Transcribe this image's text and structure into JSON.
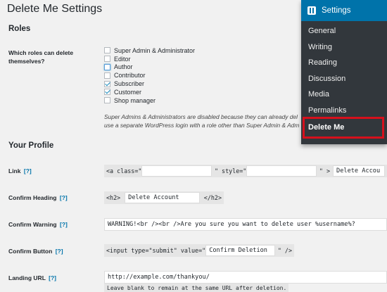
{
  "page": {
    "title": "Delete Me Settings"
  },
  "roles_section": {
    "heading": "Roles",
    "label": "Which roles can delete themselves?",
    "roles": [
      {
        "name": "Super Admin & Administrator",
        "checked": false
      },
      {
        "name": "Editor",
        "checked": false
      },
      {
        "name": "Author",
        "checked": false
      },
      {
        "name": "Contributor",
        "checked": false
      },
      {
        "name": "Subscriber",
        "checked": true
      },
      {
        "name": "Customer",
        "checked": true
      },
      {
        "name": "Shop manager",
        "checked": false
      }
    ],
    "note_line1": "Super Admins & Administrators are disabled because they can already del",
    "note_line2": "use a separate WordPress login with a role other than Super Admin & Adm"
  },
  "profile_section": {
    "heading": "Your Profile",
    "help": "[?]",
    "link": {
      "label": "Link",
      "code_a_open": "<a class=\"",
      "code_style": "\" style=\"",
      "code_close": "\" >",
      "class_value": "",
      "style_value": "",
      "text_value": "Delete Accou"
    },
    "confirm_heading": {
      "label": "Confirm Heading",
      "code_open": "<h2>",
      "value": "Delete Account",
      "code_close": "</h2>"
    },
    "confirm_warning": {
      "label": "Confirm Warning",
      "value": "WARNING!<br /><br />Are you sure you want to delete user %username%?"
    },
    "confirm_button": {
      "label": "Confirm Button",
      "code_open": "<input type=\"submit\" value=\"",
      "value": "Confirm Deletion",
      "code_close": "\" />"
    },
    "landing_url": {
      "label": "Landing URL",
      "value": "http://example.com/thankyou/",
      "description": "Leave blank to remain at the same URL after deletion."
    }
  },
  "settings_menu": {
    "title": "Settings",
    "icon": "settings-icon",
    "items": [
      "General",
      "Writing",
      "Reading",
      "Discussion",
      "Media",
      "Permalinks",
      "Delete Me"
    ],
    "active": "Delete Me",
    "highlight_color": "#d6101c",
    "header_color": "#0073aa",
    "menu_bg": "#32373c"
  }
}
